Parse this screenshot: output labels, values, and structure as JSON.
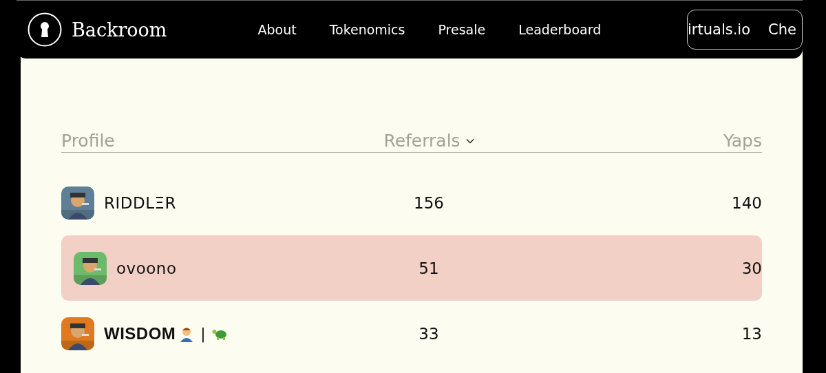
{
  "nav": {
    "brand": "Backroom",
    "links": [
      {
        "label": "About"
      },
      {
        "label": "Tokenomics"
      },
      {
        "label": "Presale"
      },
      {
        "label": "Leaderboard"
      }
    ],
    "ticker": [
      "irtuals.io",
      "Che"
    ]
  },
  "table": {
    "columns": [
      {
        "label": "Profile",
        "sorted": false
      },
      {
        "label": "Referrals",
        "sorted": true
      },
      {
        "label": "Yaps",
        "sorted": false
      }
    ],
    "rows": [
      {
        "name": "RIDDLΞR",
        "bold": false,
        "referrals": "156",
        "yaps": "140",
        "selected": false,
        "color": "#5f7f96"
      },
      {
        "name": "ovoono",
        "bold": false,
        "referrals": "51",
        "yaps": "30",
        "selected": true,
        "color": "#6cbb6a"
      },
      {
        "name": "WISDOM",
        "bold": true,
        "separator": "|",
        "referrals": "33",
        "yaps": "13",
        "selected": false,
        "color": "#e0791f"
      }
    ]
  }
}
